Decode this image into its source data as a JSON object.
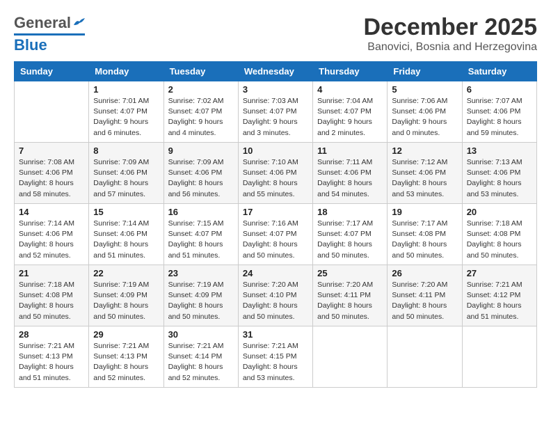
{
  "header": {
    "logo": {
      "general": "General",
      "blue": "Blue"
    },
    "month_title": "December 2025",
    "subtitle": "Banovici, Bosnia and Herzegovina"
  },
  "calendar": {
    "days_of_week": [
      "Sunday",
      "Monday",
      "Tuesday",
      "Wednesday",
      "Thursday",
      "Friday",
      "Saturday"
    ],
    "weeks": [
      [
        {
          "day": "",
          "info": ""
        },
        {
          "day": "1",
          "info": "Sunrise: 7:01 AM\nSunset: 4:07 PM\nDaylight: 9 hours\nand 6 minutes."
        },
        {
          "day": "2",
          "info": "Sunrise: 7:02 AM\nSunset: 4:07 PM\nDaylight: 9 hours\nand 4 minutes."
        },
        {
          "day": "3",
          "info": "Sunrise: 7:03 AM\nSunset: 4:07 PM\nDaylight: 9 hours\nand 3 minutes."
        },
        {
          "day": "4",
          "info": "Sunrise: 7:04 AM\nSunset: 4:07 PM\nDaylight: 9 hours\nand 2 minutes."
        },
        {
          "day": "5",
          "info": "Sunrise: 7:06 AM\nSunset: 4:06 PM\nDaylight: 9 hours\nand 0 minutes."
        },
        {
          "day": "6",
          "info": "Sunrise: 7:07 AM\nSunset: 4:06 PM\nDaylight: 8 hours\nand 59 minutes."
        }
      ],
      [
        {
          "day": "7",
          "info": "Sunrise: 7:08 AM\nSunset: 4:06 PM\nDaylight: 8 hours\nand 58 minutes."
        },
        {
          "day": "8",
          "info": "Sunrise: 7:09 AM\nSunset: 4:06 PM\nDaylight: 8 hours\nand 57 minutes."
        },
        {
          "day": "9",
          "info": "Sunrise: 7:09 AM\nSunset: 4:06 PM\nDaylight: 8 hours\nand 56 minutes."
        },
        {
          "day": "10",
          "info": "Sunrise: 7:10 AM\nSunset: 4:06 PM\nDaylight: 8 hours\nand 55 minutes."
        },
        {
          "day": "11",
          "info": "Sunrise: 7:11 AM\nSunset: 4:06 PM\nDaylight: 8 hours\nand 54 minutes."
        },
        {
          "day": "12",
          "info": "Sunrise: 7:12 AM\nSunset: 4:06 PM\nDaylight: 8 hours\nand 53 minutes."
        },
        {
          "day": "13",
          "info": "Sunrise: 7:13 AM\nSunset: 4:06 PM\nDaylight: 8 hours\nand 53 minutes."
        }
      ],
      [
        {
          "day": "14",
          "info": "Sunrise: 7:14 AM\nSunset: 4:06 PM\nDaylight: 8 hours\nand 52 minutes."
        },
        {
          "day": "15",
          "info": "Sunrise: 7:14 AM\nSunset: 4:06 PM\nDaylight: 8 hours\nand 51 minutes."
        },
        {
          "day": "16",
          "info": "Sunrise: 7:15 AM\nSunset: 4:07 PM\nDaylight: 8 hours\nand 51 minutes."
        },
        {
          "day": "17",
          "info": "Sunrise: 7:16 AM\nSunset: 4:07 PM\nDaylight: 8 hours\nand 50 minutes."
        },
        {
          "day": "18",
          "info": "Sunrise: 7:17 AM\nSunset: 4:07 PM\nDaylight: 8 hours\nand 50 minutes."
        },
        {
          "day": "19",
          "info": "Sunrise: 7:17 AM\nSunset: 4:08 PM\nDaylight: 8 hours\nand 50 minutes."
        },
        {
          "day": "20",
          "info": "Sunrise: 7:18 AM\nSunset: 4:08 PM\nDaylight: 8 hours\nand 50 minutes."
        }
      ],
      [
        {
          "day": "21",
          "info": "Sunrise: 7:18 AM\nSunset: 4:08 PM\nDaylight: 8 hours\nand 50 minutes."
        },
        {
          "day": "22",
          "info": "Sunrise: 7:19 AM\nSunset: 4:09 PM\nDaylight: 8 hours\nand 50 minutes."
        },
        {
          "day": "23",
          "info": "Sunrise: 7:19 AM\nSunset: 4:09 PM\nDaylight: 8 hours\nand 50 minutes."
        },
        {
          "day": "24",
          "info": "Sunrise: 7:20 AM\nSunset: 4:10 PM\nDaylight: 8 hours\nand 50 minutes."
        },
        {
          "day": "25",
          "info": "Sunrise: 7:20 AM\nSunset: 4:11 PM\nDaylight: 8 hours\nand 50 minutes."
        },
        {
          "day": "26",
          "info": "Sunrise: 7:20 AM\nSunset: 4:11 PM\nDaylight: 8 hours\nand 50 minutes."
        },
        {
          "day": "27",
          "info": "Sunrise: 7:21 AM\nSunset: 4:12 PM\nDaylight: 8 hours\nand 51 minutes."
        }
      ],
      [
        {
          "day": "28",
          "info": "Sunrise: 7:21 AM\nSunset: 4:13 PM\nDaylight: 8 hours\nand 51 minutes."
        },
        {
          "day": "29",
          "info": "Sunrise: 7:21 AM\nSunset: 4:13 PM\nDaylight: 8 hours\nand 52 minutes."
        },
        {
          "day": "30",
          "info": "Sunrise: 7:21 AM\nSunset: 4:14 PM\nDaylight: 8 hours\nand 52 minutes."
        },
        {
          "day": "31",
          "info": "Sunrise: 7:21 AM\nSunset: 4:15 PM\nDaylight: 8 hours\nand 53 minutes."
        },
        {
          "day": "",
          "info": ""
        },
        {
          "day": "",
          "info": ""
        },
        {
          "day": "",
          "info": ""
        }
      ]
    ]
  }
}
